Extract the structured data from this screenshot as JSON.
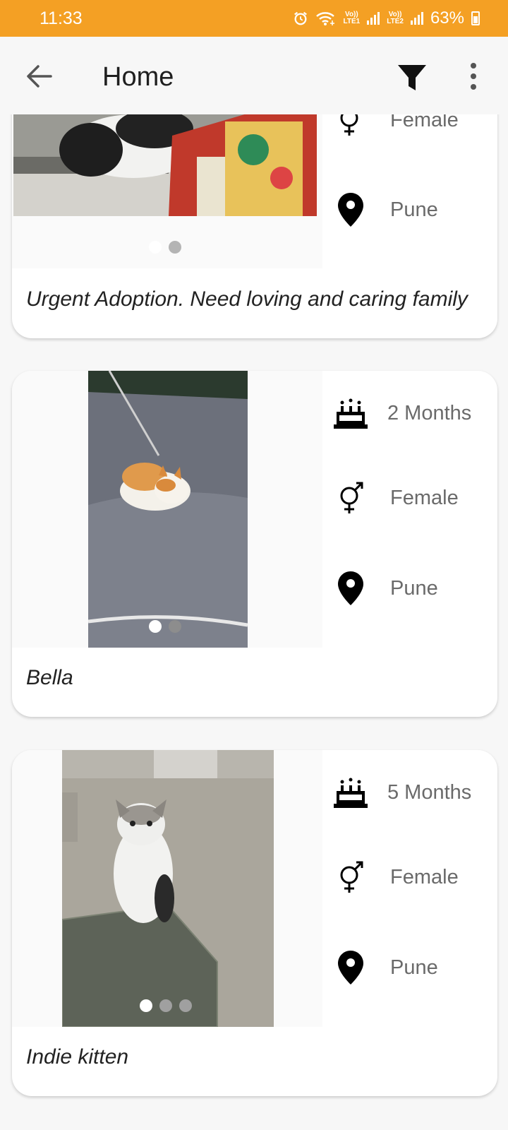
{
  "status_bar": {
    "time": "11:33",
    "network1_top": "Vo))",
    "network1_bottom": "LTE1",
    "network2_top": "Vo))",
    "network2_bottom": "LTE2",
    "battery": "63%"
  },
  "app_bar": {
    "title": "Home",
    "back_icon": "arrow-back-icon",
    "filter_icon": "filter-icon",
    "more_icon": "more-vert-icon"
  },
  "listings": [
    {
      "gender": "Female",
      "location": "Pune",
      "description": "Urgent Adoption. Need loving and caring family"
    },
    {
      "age": "2 Months",
      "gender": "Female",
      "location": "Pune",
      "description": "Bella"
    },
    {
      "age": "5 Months",
      "gender": "Female",
      "location": "Pune",
      "description": "Indie kitten"
    }
  ],
  "colors": {
    "status_bar": "#f4a024",
    "background": "#f7f7f7",
    "card": "#ffffff"
  }
}
